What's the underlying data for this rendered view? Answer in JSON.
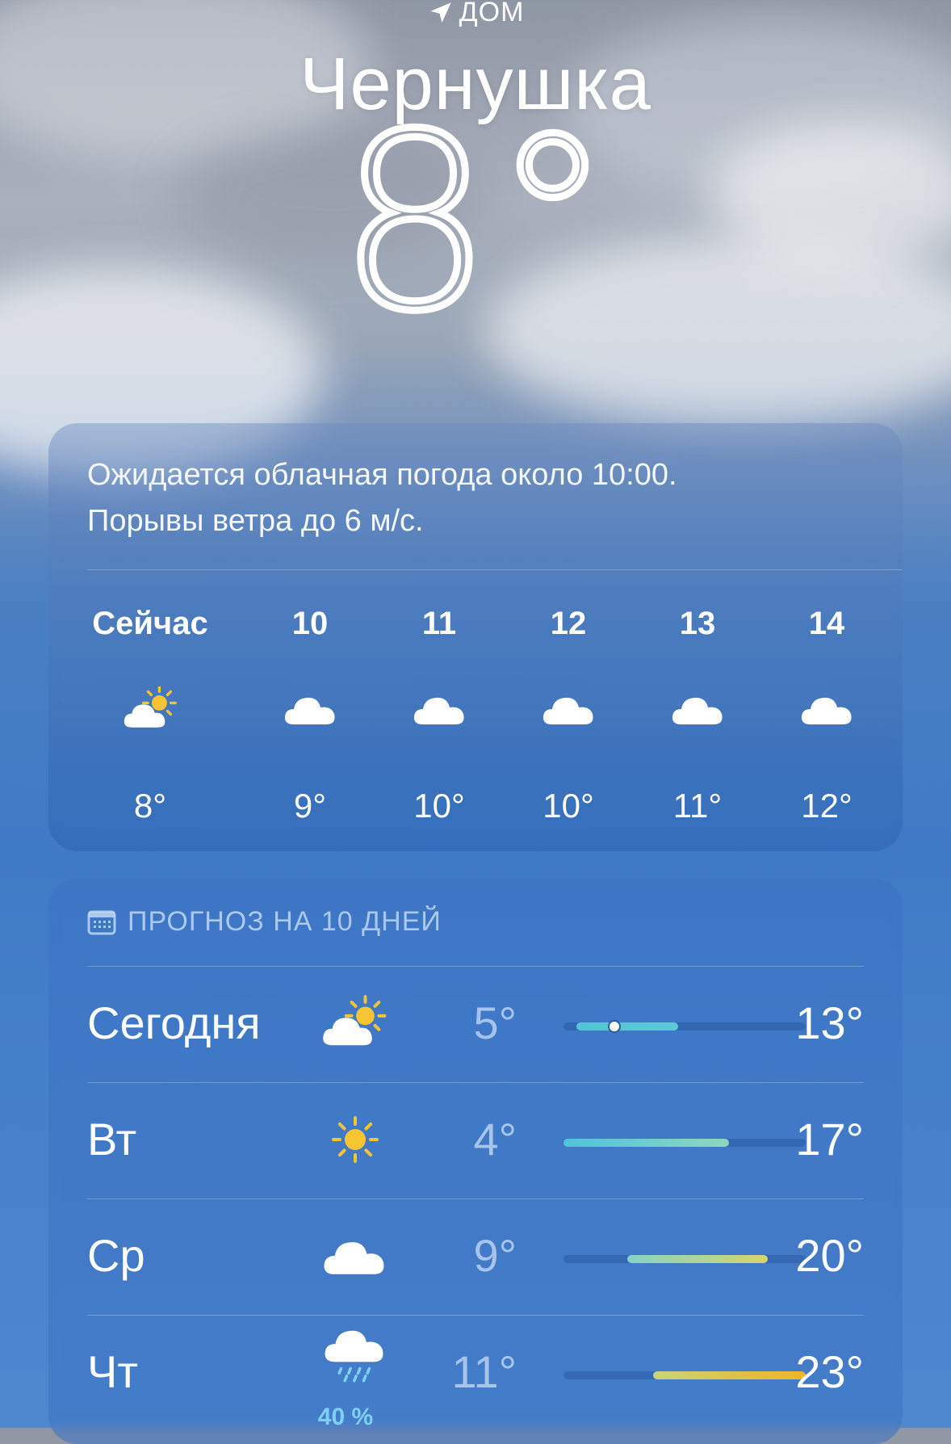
{
  "location": {
    "label": "ДОМ",
    "icon": "location-arrow-icon"
  },
  "city": "Чернушка",
  "current_temp": "8°",
  "summary": {
    "line1": "Ожидается облачная погода около 10:00.",
    "line2": "Порывы ветра до 6 м/с."
  },
  "hourly": [
    {
      "time": "Сейчас",
      "icon": "partly-sunny-icon",
      "temp": "8°"
    },
    {
      "time": "10",
      "icon": "cloud-icon",
      "temp": "9°"
    },
    {
      "time": "11",
      "icon": "cloud-icon",
      "temp": "10°"
    },
    {
      "time": "12",
      "icon": "cloud-icon",
      "temp": "10°"
    },
    {
      "time": "13",
      "icon": "cloud-icon",
      "temp": "11°"
    },
    {
      "time": "14",
      "icon": "cloud-icon",
      "temp": "12°"
    }
  ],
  "forecast": {
    "title": "ПРОГНОЗ НА 10 ДНЕЙ",
    "title_icon": "calendar-icon",
    "range_min": 4,
    "range_max": 23,
    "days": [
      {
        "day": "Сегодня",
        "icon": "partly-sunny-icon",
        "low": "5°",
        "high": "13°",
        "low_val": 5,
        "high_val": 13,
        "current_val": 8,
        "colors": [
          "#56c4d8",
          "#5cc9d6"
        ]
      },
      {
        "day": "Вт",
        "icon": "sun-icon",
        "low": "4°",
        "high": "17°",
        "low_val": 4,
        "high_val": 17,
        "colors": [
          "#4fc4db",
          "#8fd6bf"
        ]
      },
      {
        "day": "Ср",
        "icon": "cloud-icon",
        "low": "9°",
        "high": "20°",
        "low_val": 9,
        "high_val": 20,
        "colors": [
          "#86d3c8",
          "#d8d56a"
        ]
      },
      {
        "day": "Чт",
        "icon": "rain-cloud-icon",
        "low": "11°",
        "high": "23°",
        "low_val": 11,
        "high_val": 23,
        "precip": "40 %",
        "colors": [
          "#c7d57a",
          "#f2b325"
        ]
      }
    ]
  },
  "colors": {
    "sun": "#f6c531",
    "cloud": "#ffffff",
    "precip": "#7fd0f5"
  }
}
